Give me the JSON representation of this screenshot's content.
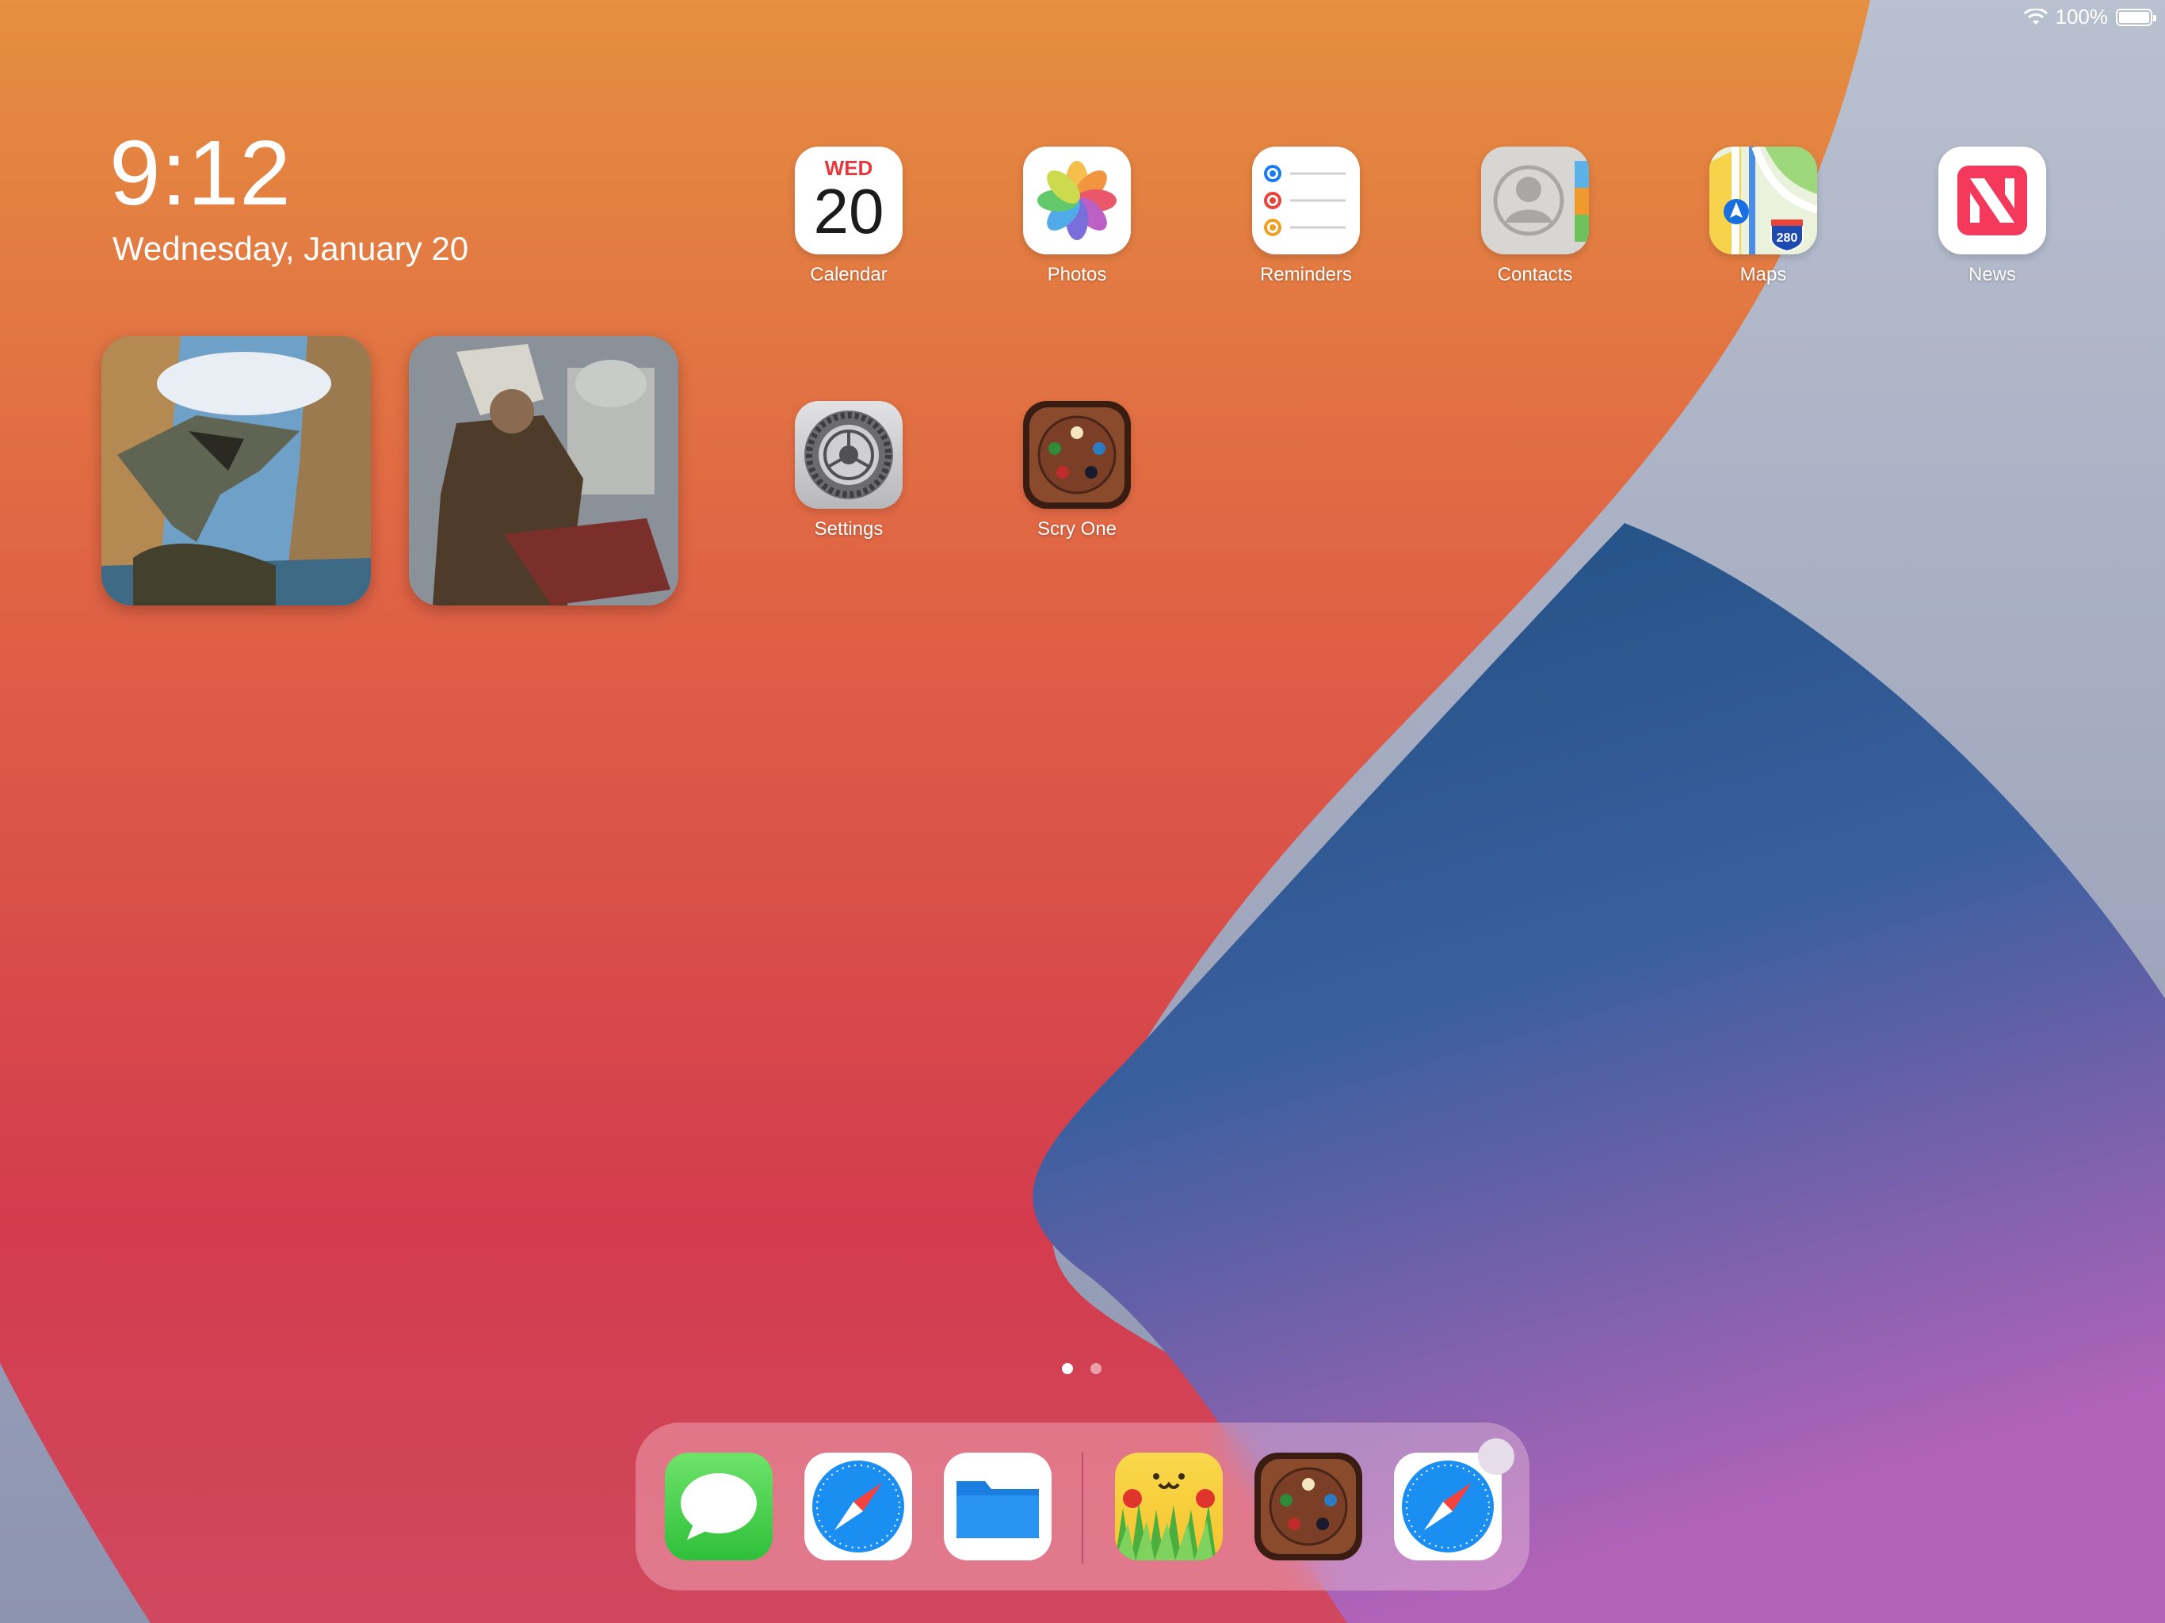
{
  "status_bar": {
    "battery": "100%"
  },
  "home": {
    "time": "9:12",
    "date": "Wednesday, January 20"
  },
  "widgets": [
    {
      "name": "photo-widget-shark"
    },
    {
      "name": "photo-widget-warrior"
    }
  ],
  "apps": [
    {
      "label": "Calendar",
      "day_abbr": "WED",
      "day_number": "20"
    },
    {
      "label": "Photos"
    },
    {
      "label": "Reminders"
    },
    {
      "label": "Contacts"
    },
    {
      "label": "Maps",
      "route": "280"
    },
    {
      "label": "News"
    },
    {
      "label": "Settings"
    },
    {
      "label": "Scry One"
    }
  ],
  "page_indicator": {
    "pages": 2,
    "current": 1
  },
  "dock": {
    "apps": [
      "messages",
      "safari",
      "files",
      "creature-game",
      "scry-one",
      "safari-recent"
    ]
  },
  "colors": {
    "wallpaper_orange": "#e58f40",
    "wallpaper_red": "#d33c4d",
    "wallpaper_blue": "#2d5c96",
    "wallpaper_purple": "#a35ab0",
    "wallpaper_gray": "#a8b2c4"
  }
}
